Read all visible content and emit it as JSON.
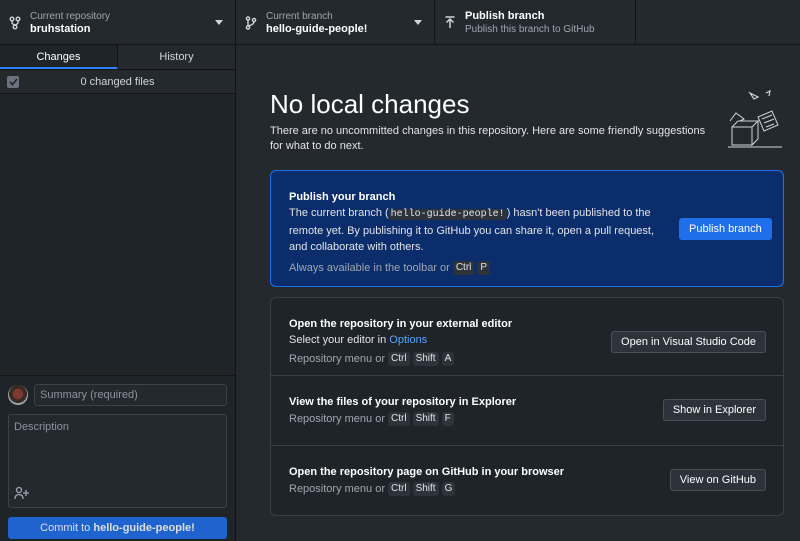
{
  "toolbar": {
    "repository": {
      "label": "Current repository",
      "value": "bruhstation"
    },
    "branch": {
      "label": "Current branch",
      "value": "hello-guide-people!"
    },
    "publish": {
      "label": "Publish branch",
      "sub": "Publish this branch to GitHub"
    }
  },
  "sidebar": {
    "tabs": [
      {
        "label": "Changes",
        "active": true
      },
      {
        "label": "History",
        "active": false
      }
    ],
    "changes_count": "0 changed files",
    "summary_placeholder": "Summary (required)",
    "description_placeholder": "Description",
    "commit_prefix": "Commit to ",
    "commit_branch": "hello-guide-people!"
  },
  "main": {
    "heading": "No local changes",
    "subtext": "There are no uncommitted changes in this repository. Here are some friendly suggestions for what to do next.",
    "publish_card": {
      "title": "Publish your branch",
      "body_1": "The current branch (",
      "branch_code": "hello-guide-people!",
      "body_2": ") hasn't been published to the remote yet. By publishing it to GitHub you can share it, open a pull request, and collaborate with others.",
      "hint": "Always available in the toolbar or",
      "keys": [
        "Ctrl",
        "P"
      ],
      "button": "Publish branch"
    },
    "suggestions": [
      {
        "title": "Open the repository in your external editor",
        "body": "Select your editor in ",
        "link": "Options",
        "hint": "Repository menu or",
        "keys": [
          "Ctrl",
          "Shift",
          "A"
        ],
        "button": "Open in Visual Studio Code"
      },
      {
        "title": "View the files of your repository in Explorer",
        "hint": "Repository menu or",
        "keys": [
          "Ctrl",
          "Shift",
          "F"
        ],
        "button": "Show in Explorer"
      },
      {
        "title": "Open the repository page on GitHub in your browser",
        "hint": "Repository menu or",
        "keys": [
          "Ctrl",
          "Shift",
          "G"
        ],
        "button": "View on GitHub"
      }
    ]
  },
  "colors": {
    "accent": "#1f6feb",
    "publish_card_bg": "#0c2d6b",
    "background": "#24292e"
  }
}
